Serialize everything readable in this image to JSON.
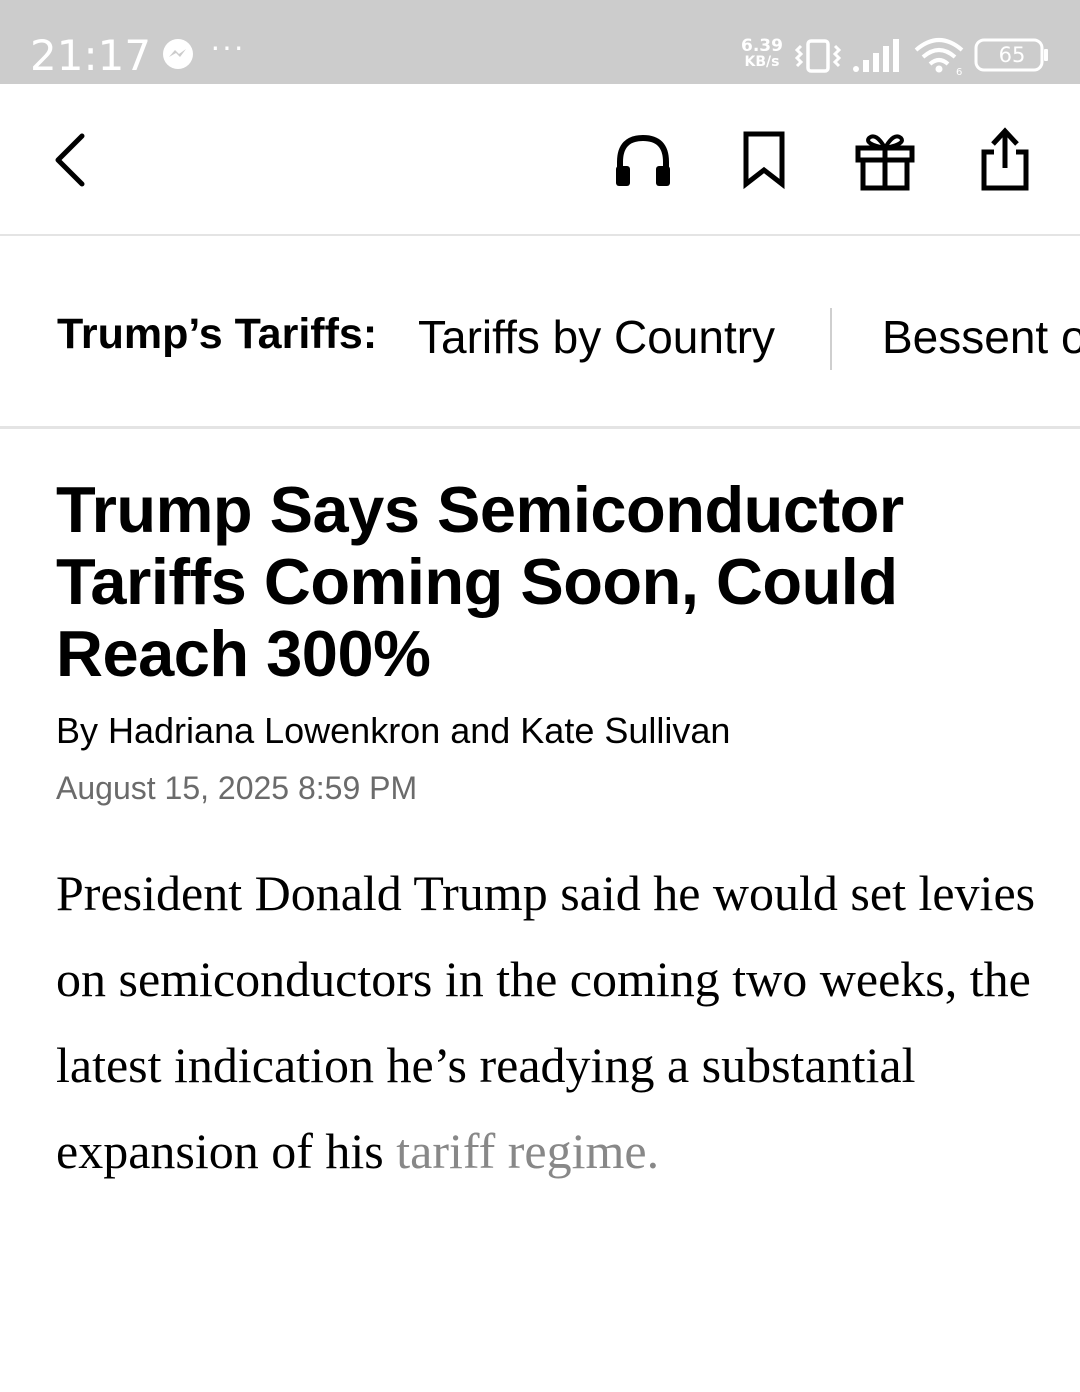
{
  "status_bar": {
    "time": "21:17",
    "notification_icons": [
      "messenger-icon",
      "more-dots-icon"
    ],
    "more_dots": "···",
    "net_speed_value": "6.39",
    "net_speed_unit": "KB/s",
    "battery_level": "65",
    "background_color": "#cccccc"
  },
  "toolbar": {
    "icons": [
      "back-icon",
      "headphones-icon",
      "bookmark-icon",
      "gift-icon",
      "share-icon"
    ]
  },
  "topic_nav": {
    "label": "Trump’s Tariffs:",
    "links": [
      "Tariffs by Country",
      "Bessent o"
    ]
  },
  "article": {
    "headline": "Trump Says Semiconductor Tariffs Coming Soon, Could Reach 300%",
    "byline": "By Hadriana Lowenkron and Kate Sullivan",
    "date": "August 15, 2025 8:59 PM",
    "lede_main": "President Donald Trump said he would set levies on semiconductors in the coming two weeks, the latest indication he’s readying a substantial expansion of his ",
    "lede_fade": "tariff regime."
  }
}
